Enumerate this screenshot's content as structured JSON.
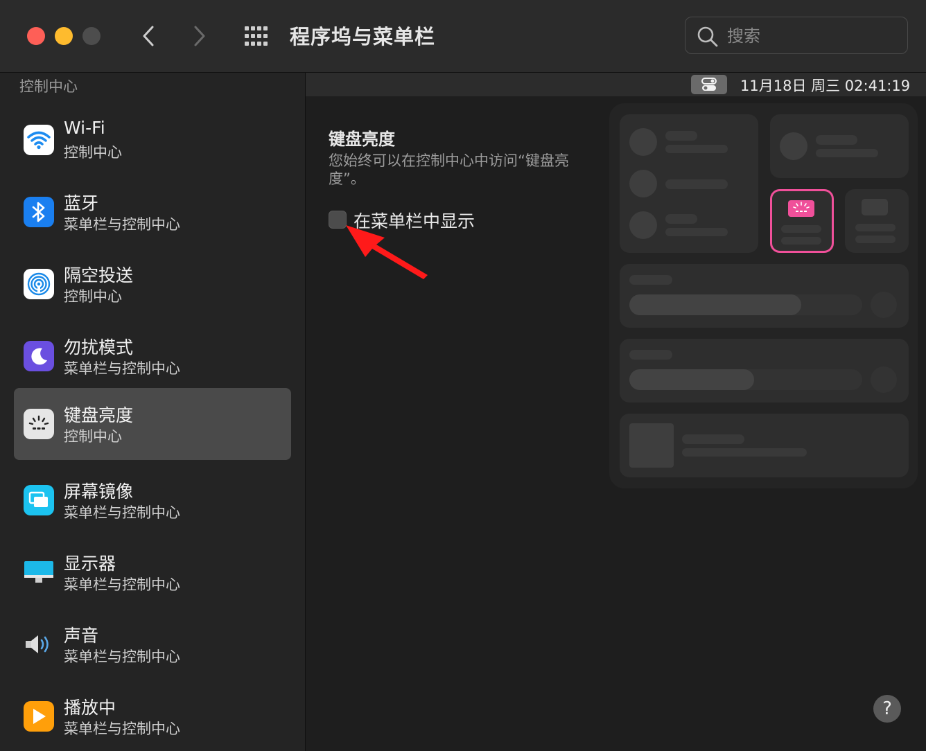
{
  "window": {
    "title": "程序坞与菜单栏"
  },
  "search": {
    "placeholder": "搜索",
    "icon": "search-icon"
  },
  "sidebar": {
    "header": "控制中心",
    "items": [
      {
        "title": "Wi-Fi",
        "subtitle": "控制中心",
        "icon": "wifi-icon",
        "color": "#1d8cf0"
      },
      {
        "title": "蓝牙",
        "subtitle": "菜单栏与控制中心",
        "icon": "bluetooth-icon",
        "color": "#1a7ff0"
      },
      {
        "title": "隔空投送",
        "subtitle": "控制中心",
        "icon": "airdrop-icon",
        "color": "#ffffff"
      },
      {
        "title": "勿扰模式",
        "subtitle": "菜单栏与控制中心",
        "icon": "moon-icon",
        "color": "#6a4fe0"
      },
      {
        "title": "键盘亮度",
        "subtitle": "控制中心",
        "icon": "keyboard-brightness-icon",
        "color": "#e6e6e6",
        "selected": true
      },
      {
        "title": "屏幕镜像",
        "subtitle": "菜单栏与控制中心",
        "icon": "screen-mirroring-icon",
        "color": "#1cc3f0"
      },
      {
        "title": "显示器",
        "subtitle": "菜单栏与控制中心",
        "icon": "display-icon",
        "color": "#1cb8e8"
      },
      {
        "title": "声音",
        "subtitle": "菜单栏与控制中心",
        "icon": "speaker-icon",
        "color": "#cfcfcf"
      },
      {
        "title": "播放中",
        "subtitle": "菜单栏与控制中心",
        "icon": "play-icon",
        "color": "#ff9f0a"
      }
    ]
  },
  "menubar": {
    "clock": "11月18日 周三  02:41:19"
  },
  "detail": {
    "title": "键盘亮度",
    "description": "您始终可以在控制中心中访问“键盘亮度”。",
    "checkbox_label": "在菜单栏中显示",
    "checkbox_checked": false
  },
  "colors": {
    "highlight": "#f0509a",
    "arrow": "#ff1a1a"
  },
  "help": {
    "label": "?"
  }
}
